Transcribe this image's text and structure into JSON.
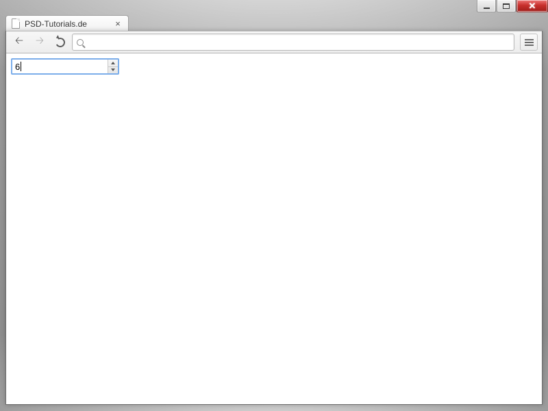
{
  "tab": {
    "title": "PSD-Tutorials.de"
  },
  "omnibox": {
    "value": ""
  },
  "page": {
    "number_input": {
      "value": "6"
    }
  }
}
